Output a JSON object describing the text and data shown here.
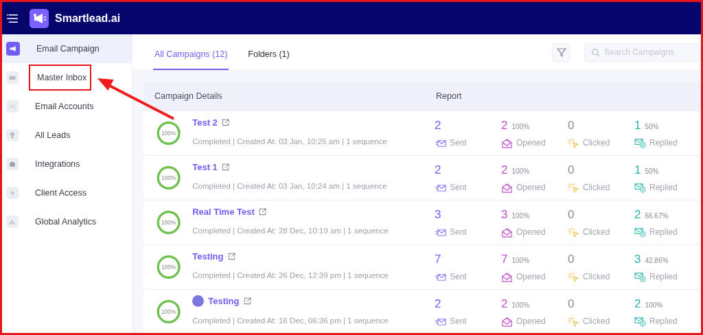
{
  "app": {
    "name": "Smartlead.ai"
  },
  "sidebar": {
    "items": [
      {
        "label": "Email Campaign",
        "selected": true,
        "highlighted": false
      },
      {
        "label": "Master Inbox",
        "selected": false,
        "highlighted": true
      },
      {
        "label": "Email Accounts",
        "selected": false,
        "highlighted": false
      },
      {
        "label": "All Leads",
        "selected": false,
        "highlighted": false
      },
      {
        "label": "Integrations",
        "selected": false,
        "highlighted": false
      },
      {
        "label": "Client Access",
        "selected": false,
        "highlighted": false
      },
      {
        "label": "Global Analytics",
        "selected": false,
        "highlighted": false
      }
    ]
  },
  "tabs": [
    {
      "label": "All Campaigns (12)",
      "selected": true
    },
    {
      "label": "Folders (1)",
      "selected": false
    }
  ],
  "search": {
    "placeholder": "Search Campaigns"
  },
  "table": {
    "columns": [
      "Campaign Details",
      "Report"
    ],
    "rows": [
      {
        "progress": "100%",
        "level": 1,
        "name": "Test 2",
        "avatar": false,
        "details": "Completed | Created At: 03 Jan, 10:25 am | 1 sequence",
        "stats": [
          {
            "kind": "sent",
            "value": "2",
            "label": "Sent"
          },
          {
            "kind": "opened",
            "value": "2",
            "percent": "100%",
            "label": "Opened"
          },
          {
            "kind": "clicked",
            "value": "0",
            "label": "Clicked"
          },
          {
            "kind": "replied",
            "value": "1",
            "percent": "50%",
            "label": "Replied"
          }
        ]
      },
      {
        "progress": "100%",
        "level": 1,
        "name": "Test 1",
        "avatar": false,
        "details": "Completed | Created At: 03 Jan, 10:24 am | 1 sequence",
        "stats": [
          {
            "kind": "sent",
            "value": "2",
            "label": "Sent"
          },
          {
            "kind": "opened",
            "value": "2",
            "percent": "100%",
            "label": "Opened"
          },
          {
            "kind": "clicked",
            "value": "0",
            "label": "Clicked"
          },
          {
            "kind": "replied",
            "value": "1",
            "percent": "50%",
            "label": "Replied"
          }
        ]
      },
      {
        "progress": "100%",
        "level": 1,
        "name": "Real Time Test",
        "avatar": false,
        "details": "Completed | Created At: 28 Dec, 10:19 am | 1 sequence",
        "stats": [
          {
            "kind": "sent",
            "value": "3",
            "label": "Sent"
          },
          {
            "kind": "opened",
            "value": "3",
            "percent": "100%",
            "label": "Opened"
          },
          {
            "kind": "clicked",
            "value": "0",
            "label": "Clicked"
          },
          {
            "kind": "replied",
            "value": "2",
            "percent": "66.67%",
            "label": "Replied"
          }
        ]
      },
      {
        "progress": "100%",
        "level": 1,
        "name": "Testing",
        "avatar": false,
        "details": "Completed | Created At: 26 Dec, 12:39 pm | 1 sequence",
        "stats": [
          {
            "kind": "sent",
            "value": "7",
            "label": "Sent"
          },
          {
            "kind": "opened",
            "value": "7",
            "percent": "100%",
            "label": "Opened"
          },
          {
            "kind": "clicked",
            "value": "0",
            "label": "Clicked"
          },
          {
            "kind": "replied",
            "value": "3",
            "percent": "42.86%",
            "label": "Replied"
          }
        ]
      },
      {
        "progress": "100%",
        "level": 1,
        "name": "Testing",
        "avatar": true,
        "details": "Completed | Created At: 16 Dec, 06:36 pm | 1 sequence",
        "stats": [
          {
            "kind": "sent",
            "value": "2",
            "label": "Sent"
          },
          {
            "kind": "opened",
            "value": "2",
            "percent": "100%",
            "label": "Opened"
          },
          {
            "kind": "clicked",
            "value": "0",
            "label": "Clicked"
          },
          {
            "kind": "replied",
            "value": "2",
            "percent": "100%",
            "label": "Replied"
          }
        ]
      }
    ]
  }
}
